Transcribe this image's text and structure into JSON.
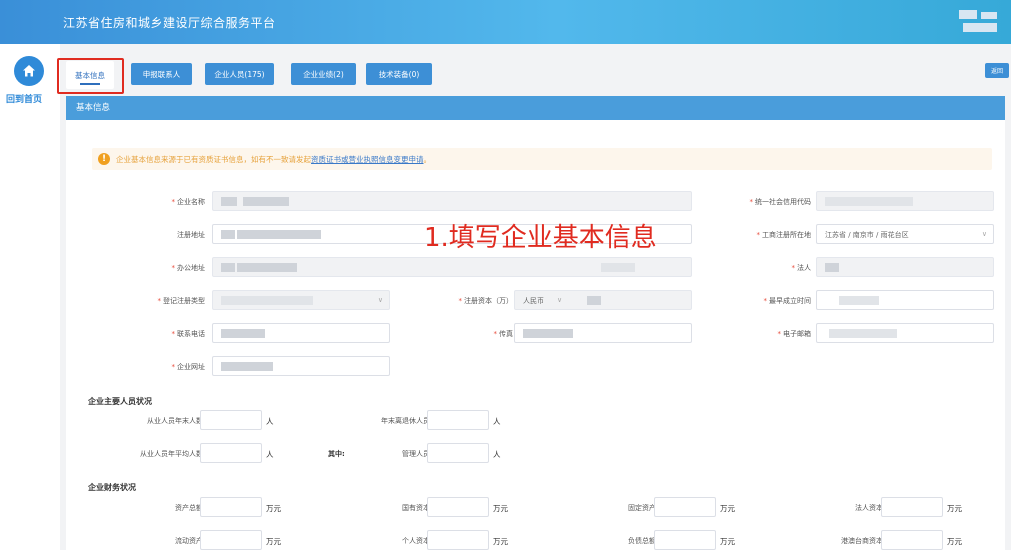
{
  "header": {
    "title": "江苏省住房和城乡建设厅综合服务平台"
  },
  "sidebar": {
    "home_label": "回到首页"
  },
  "tabs": [
    {
      "label": "基本信息",
      "active": true
    },
    {
      "label": "申报联系人"
    },
    {
      "label": "企业人员(175)"
    },
    {
      "label": "企业业绩(2)"
    },
    {
      "label": "技术装备(0)"
    }
  ],
  "return_label": "返回",
  "panel_title": "基本信息",
  "notice": {
    "text": "企业基本信息来源于已有资质证书信息，如有不一致请发起",
    "link": "资质证书或营业执照信息变更申请",
    "end": "。"
  },
  "overlay_annotation": "1.填写企业基本信息",
  "fields": {
    "company_name": "企业名称",
    "credit_code": "统一社会信用代码",
    "reg_address": "注册地址",
    "biz_location": "工商注册所在地",
    "biz_location_value": "江苏省 / 南京市 / 雨花台区",
    "office_address": "办公地址",
    "legal_person": "法人",
    "reg_type": "登记注册类型",
    "reg_capital": "注册资本（万）",
    "currency": "人民币",
    "founded": "最早成立时间",
    "phone": "联系电话",
    "fax": "传真",
    "email": "电子邮箱",
    "website": "企业网址"
  },
  "staff_section": {
    "title": "企业主要人员状况",
    "year_end_count": "从业人员年末人数",
    "retired": "年末离退休人员",
    "avg_count": "从业人员年平均人数",
    "of_which": "其中:",
    "managers": "管理人员",
    "unit": "人"
  },
  "finance_section": {
    "title": "企业财务状况",
    "total_assets": "资产总额",
    "state_capital": "国有资本",
    "fixed_assets": "固定资产",
    "corporate_capital": "法人资本",
    "current_assets": "流动资产",
    "personal_capital": "个人资本",
    "total_liabilities": "负债总额",
    "hk_macao_tw_capital": "港澳台商资本",
    "unit": "万元"
  },
  "colors": {
    "header": "#3a8fd8",
    "tab": "#3d8fd6",
    "highlight": "#e02b20",
    "notice_bg": "#fdf6ec"
  }
}
